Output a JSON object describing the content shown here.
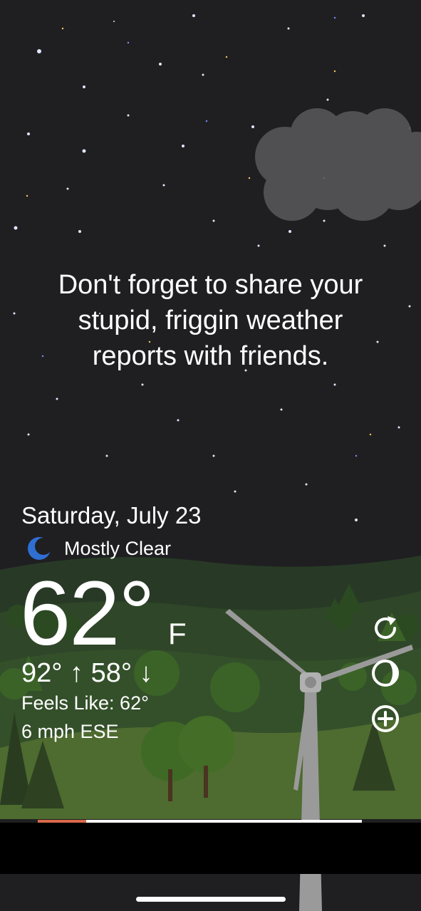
{
  "message": {
    "lines": [
      "Don't forget to share your",
      "stupid, friggin weather",
      "reports with friends."
    ]
  },
  "weather": {
    "date": "Saturday, July 23",
    "condition": "Mostly Clear",
    "condition_icon": "crescent-moon-icon",
    "temperature": "62°",
    "unit": "F",
    "high": "92°",
    "low": "58°",
    "high_arrow": "↑",
    "low_arrow": "↓",
    "feels_like": "Feels Like: 62°",
    "wind": "6 mph ESE"
  },
  "controls": [
    {
      "name": "refresh-icon"
    },
    {
      "name": "moon-phase-icon"
    },
    {
      "name": "add-icon"
    }
  ],
  "ad_progress": 0.15,
  "colors": {
    "night_sky": "#1f1f21",
    "hill_dark": "#283a26",
    "hill_mid": "#3d5a2b",
    "grass": "#4e6b30",
    "cloud": "#5a5a5a",
    "moon_blue": "#2f6fd4",
    "progress_accent": "#d96a4a"
  }
}
